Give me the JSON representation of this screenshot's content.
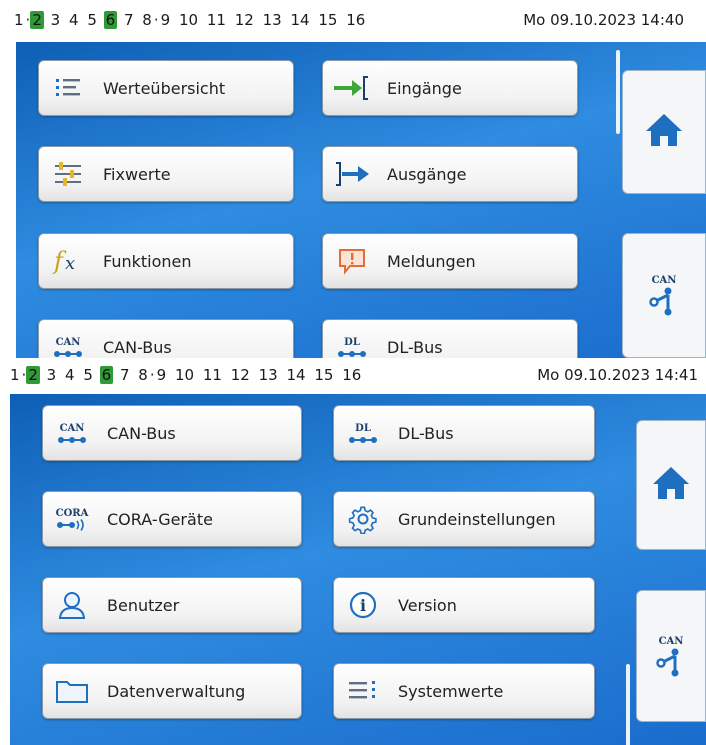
{
  "top_panel": {
    "status": {
      "items": [
        {
          "text": "1",
          "active": false
        },
        {
          "text": "·",
          "active": false,
          "sep": true
        },
        {
          "text": "2",
          "active": true
        },
        {
          "text": "3",
          "active": false
        },
        {
          "text": "4",
          "active": false
        },
        {
          "text": "5",
          "active": false
        },
        {
          "text": "6",
          "active": true
        },
        {
          "text": "7",
          "active": false
        },
        {
          "text": "8",
          "active": false
        },
        {
          "text": "·",
          "active": false,
          "sep": true
        },
        {
          "text": "9",
          "active": false
        },
        {
          "text": "10",
          "active": false
        },
        {
          "text": "11",
          "active": false
        },
        {
          "text": "12",
          "active": false
        },
        {
          "text": "13",
          "active": false
        },
        {
          "text": "14",
          "active": false
        },
        {
          "text": "15",
          "active": false
        },
        {
          "text": "16",
          "active": false
        }
      ],
      "datetime": "Mo 09.10.2023 14:40"
    },
    "tiles": [
      {
        "label": "Werteübersicht",
        "icon": "list-icon"
      },
      {
        "label": "Eingänge",
        "icon": "input-arrow-icon"
      },
      {
        "label": "Fixwerte",
        "icon": "fixed-values-icon"
      },
      {
        "label": "Ausgänge",
        "icon": "output-arrow-icon"
      },
      {
        "label": "Funktionen",
        "icon": "function-fx-icon"
      },
      {
        "label": "Meldungen",
        "icon": "message-alert-icon"
      },
      {
        "label": "CAN-Bus",
        "icon": "can-bus-icon",
        "tag": "CAN"
      },
      {
        "label": "DL-Bus",
        "icon": "dl-bus-icon",
        "tag": "DL"
      }
    ],
    "side": {
      "home_icon": "home-icon",
      "can_tag": "CAN"
    }
  },
  "bottom_panel": {
    "status": {
      "datetime": "Mo 09.10.2023 14:41"
    },
    "tiles": [
      {
        "label": "CAN-Bus",
        "icon": "can-bus-icon",
        "tag": "CAN"
      },
      {
        "label": "DL-Bus",
        "icon": "dl-bus-icon",
        "tag": "DL"
      },
      {
        "label": "CORA-Geräte",
        "icon": "cora-devices-icon",
        "tag": "CORA"
      },
      {
        "label": "Grundeinstellungen",
        "icon": "gear-icon"
      },
      {
        "label": "Benutzer",
        "icon": "user-icon"
      },
      {
        "label": "Version",
        "icon": "info-icon"
      },
      {
        "label": "Datenverwaltung",
        "icon": "folder-icon"
      },
      {
        "label": "Systemwerte",
        "icon": "system-values-icon"
      }
    ],
    "side": {
      "home_icon": "home-icon",
      "can_tag": "CAN"
    }
  },
  "colors": {
    "background_blue": "#1a6ccc",
    "active_green": "#2f9a36",
    "icon_blue": "#1f6fc1"
  }
}
